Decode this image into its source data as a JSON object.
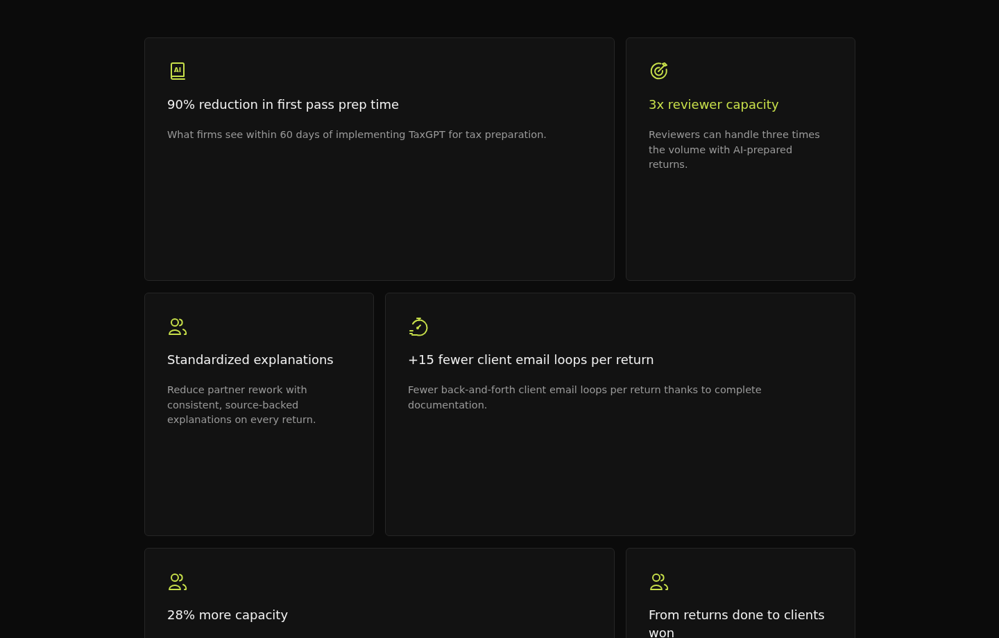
{
  "cards": [
    {
      "kind": "book",
      "icon_label": "AI",
      "title": "90% reduction in first pass prep time",
      "highlighted": false,
      "description": "What firms see within 60 days of implementing TaxGPT for tax preparation."
    },
    {
      "kind": "target",
      "title": "3x reviewer capacity",
      "highlighted": true,
      "description": "Reviewers can handle three times the volume with AI-prepared returns."
    },
    {
      "kind": "users",
      "title": "Standardized explanations",
      "highlighted": false,
      "description": "Reduce partner rework with consistent, source-backed explanations on every return."
    },
    {
      "kind": "stopwatch",
      "title": "+15 fewer client email loops per return",
      "highlighted": false,
      "description": "Fewer back-and-forth client email loops per return thanks to complete documentation."
    },
    {
      "kind": "users",
      "title": "28% more capacity",
      "highlighted": false
    },
    {
      "kind": "users",
      "title": "From returns done to clients won",
      "highlighted": false
    }
  ]
}
